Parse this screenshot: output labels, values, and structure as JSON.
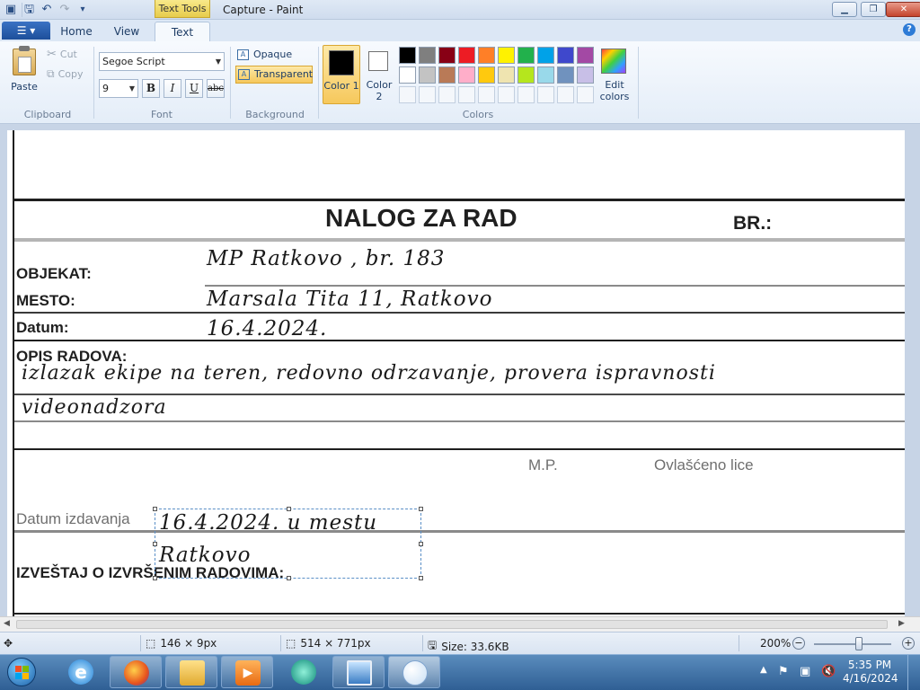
{
  "window": {
    "title": "Capture - Paint",
    "context_tab": "Text Tools"
  },
  "ribbon_tabs": [
    "Home",
    "View",
    "Text"
  ],
  "clipboard": {
    "paste": "Paste",
    "cut": "Cut",
    "copy": "Copy",
    "group": "Clipboard"
  },
  "font": {
    "name": "Segoe Script",
    "size": "9",
    "bold": "B",
    "italic": "I",
    "underline": "U",
    "strike": "abc",
    "group": "Font"
  },
  "background": {
    "opaque": "Opaque",
    "transparent": "Transparent",
    "group": "Background"
  },
  "colors": {
    "color1_label": "Color 1",
    "color2_label": "Color 2",
    "color1": "#000000",
    "color2": "#ffffff",
    "edit_colors": "Edit colors",
    "group": "Colors",
    "palette_row1": [
      "#000000",
      "#7f7f7f",
      "#880015",
      "#ed1c24",
      "#ff7f27",
      "#fff200",
      "#22b14c",
      "#00a2e8",
      "#3f48cc",
      "#a349a4"
    ],
    "palette_row2": [
      "#ffffff",
      "#c3c3c3",
      "#b97a57",
      "#ffaec9",
      "#ffc90e",
      "#efe4b0",
      "#b5e61d",
      "#99d9ea",
      "#7092be",
      "#c8bfe7"
    ]
  },
  "document": {
    "title": "NALOG ZA RAD",
    "br_label": "BR.:",
    "objekat_label": "OBJEKAT:",
    "objekat_value": "MP Ratkovo , br. 183",
    "mesto_label": "MESTO:",
    "mesto_value": "Marsala Tita 11, Ratkovo",
    "datum_label": "Datum:",
    "datum_value": "16.4.2024.",
    "opis_label": "OPIS RADOVA:",
    "opis_line1": "izlazak ekipe na teren, redovno odrzavanje, provera ispravnosti",
    "opis_line2": "videonadzora",
    "mp_label": "M.P.",
    "ovlasceno_label": "Ovlašćeno lice",
    "datum_izdavanja_label": "Datum izdavanja",
    "izdavanja_line1": "16.4.2024. u mestu",
    "izdavanja_line2": "Ratkovo",
    "izvestaj_label": "IZVEŠTAJ O IZVRŠENIM RADOVIMA:"
  },
  "status": {
    "cursor_pos": "146 × 9px",
    "canvas_size": "514 × 771px",
    "file_size": "Size: 33.6KB",
    "zoom": "200%"
  },
  "taskbar": {
    "time": "5:35 PM",
    "date": "4/16/2024"
  }
}
